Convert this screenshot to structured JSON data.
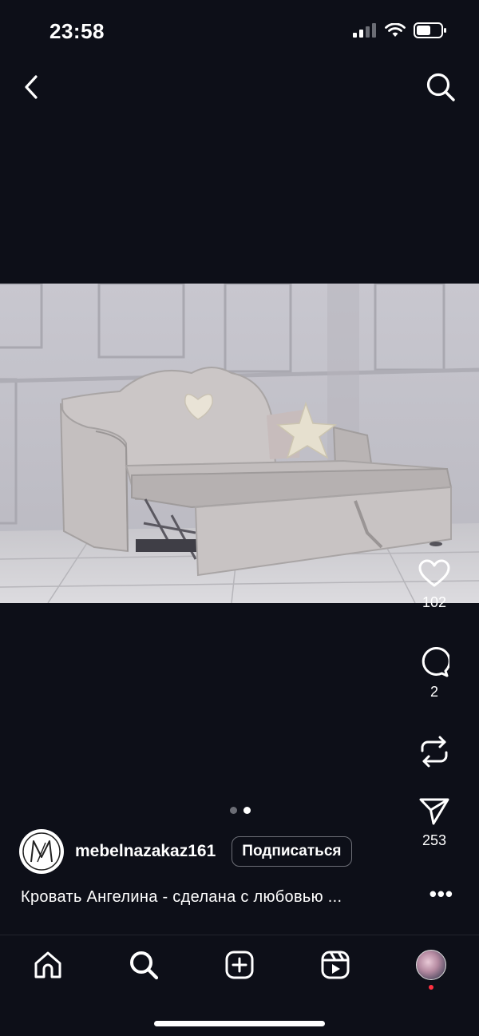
{
  "status_bar": {
    "time": "23:58"
  },
  "post": {
    "like_count": "102",
    "comment_count": "2",
    "share_count": "253",
    "carousel": {
      "total": 2,
      "active": 2
    },
    "author": {
      "username": "mebelnazakaz161",
      "follow_label": "Подписаться"
    },
    "caption": "Кровать Ангелина - сделана с любовью ...",
    "more_label": "•••"
  },
  "icons": {
    "back": "chevron-left-icon",
    "search": "search-icon",
    "like": "heart-icon",
    "comment": "comment-icon",
    "repost": "repost-icon",
    "share": "send-icon",
    "nav": [
      "home-icon",
      "search-icon",
      "add-icon",
      "reels-icon",
      "profile-avatar"
    ]
  },
  "colors": {
    "background": "#0d0f18",
    "notification_dot": "#ff3040"
  }
}
